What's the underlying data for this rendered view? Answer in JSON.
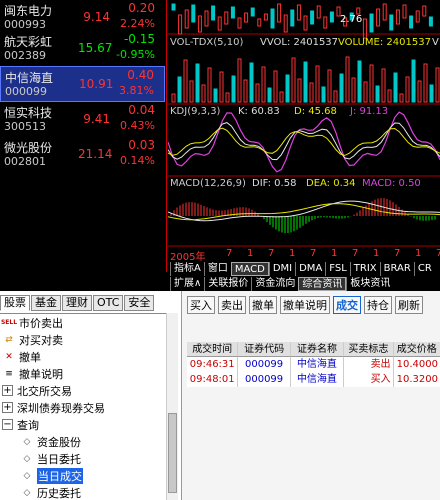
{
  "stocks": [
    {
      "name": "闽东电力",
      "code": "000993",
      "price": "9.14",
      "change": "0.20",
      "pct": "2.24%",
      "dir": "up",
      "selected": false
    },
    {
      "name": "航天彩虹",
      "code": "002389",
      "price": "15.67",
      "change": "-0.15",
      "pct": "-0.95%",
      "dir": "dn",
      "selected": false
    },
    {
      "name": "中信海直",
      "code": "000099",
      "price": "10.91",
      "change": "0.40",
      "pct": "3.81%",
      "dir": "up",
      "selected": true
    },
    {
      "name": "恒实科技",
      "code": "300513",
      "price": "9.41",
      "change": "0.04",
      "pct": "0.43%",
      "dir": "up",
      "selected": false
    },
    {
      "name": "微光股份",
      "code": "002801",
      "price": "21.14",
      "change": "0.03",
      "pct": "0.14%",
      "dir": "up",
      "selected": false
    }
  ],
  "chart": {
    "price_low": "2.76",
    "vol_title": "VOL-TDX(5,10)",
    "vol_vvol": "VVOL: 2401537",
    "vol_volume": "VOLUME: 2401537",
    "vol_right": "V",
    "kdj_title": "KDJ(9,3,3)",
    "kdj_k": "K: 60.83",
    "kdj_d": "D: 45.68",
    "kdj_j": "J: 91.13",
    "macd_title": "MACD(12,26,9)",
    "macd_dif": "DIF: 0.58",
    "macd_dea": "DEA: 0.34",
    "macd_macd": "MACD: 0.50",
    "axis_year": "2005年",
    "axis_ticks": [
      "7",
      "1",
      "7",
      "1",
      "7",
      "1",
      "7",
      "1",
      "7",
      "1",
      "7"
    ]
  },
  "indicator_tabs": [
    "指标A",
    "窗口",
    "MACD",
    "DMI",
    "DMA",
    "FSL",
    "TRIX",
    "BRAR",
    "CR"
  ],
  "indicator_active": "MACD",
  "info_tabs": [
    "扩展∧",
    "关联报价",
    "资金流向",
    "综合资讯",
    "板块资讯"
  ],
  "info_active": "综合资讯",
  "left_tabs": [
    "股票",
    "基金",
    "理财",
    "OTC",
    "安全"
  ],
  "left_active": "股票",
  "tree": [
    {
      "label": "市价卖出",
      "type": "item",
      "icon": "sell-icon",
      "glyph": "SELL"
    },
    {
      "label": "对买对卖",
      "type": "item",
      "icon": "swap-icon",
      "glyph": "⇄"
    },
    {
      "label": "撤单",
      "type": "item",
      "icon": "cancel-icon",
      "glyph": "✕"
    },
    {
      "label": "撤单说明",
      "type": "item",
      "icon": "info-icon",
      "glyph": "≡"
    },
    {
      "label": "北交所交易",
      "type": "folder",
      "icon": "expand-icon",
      "glyph": "+"
    },
    {
      "label": "深圳债券现券交易",
      "type": "folder",
      "icon": "expand-icon",
      "glyph": "+"
    },
    {
      "label": "查询",
      "type": "folder",
      "icon": "collapse-icon",
      "glyph": "−"
    },
    {
      "label": "资金股份",
      "type": "sub",
      "icon": "query-icon",
      "glyph": "◇"
    },
    {
      "label": "当日委托",
      "type": "sub",
      "icon": "query-icon",
      "glyph": "◇"
    },
    {
      "label": "当日成交",
      "type": "sub",
      "icon": "query-icon",
      "glyph": "◇",
      "selected": true
    },
    {
      "label": "历史委托",
      "type": "sub",
      "icon": "query-icon",
      "glyph": "◇"
    }
  ],
  "action_buttons": [
    "买入",
    "卖出",
    "撤单",
    "撤单说明",
    "成交",
    "持仓",
    "刷新"
  ],
  "action_active": "成交",
  "table": {
    "headers": [
      "成交时间",
      "证券代码",
      "证券名称",
      "买卖标志",
      "成交价格"
    ],
    "rows": [
      [
        "09:46:31",
        "000099",
        "中信海直",
        "卖出",
        "10.4000"
      ],
      [
        "09:48:01",
        "000099",
        "中信海直",
        "买入",
        "10.3200"
      ]
    ]
  },
  "colors": {
    "up": "#ff3232",
    "down": "#00e600",
    "selected_bg": "#1c2f8a",
    "highlight": "#1e64e6",
    "active_button": "#1464d2"
  }
}
